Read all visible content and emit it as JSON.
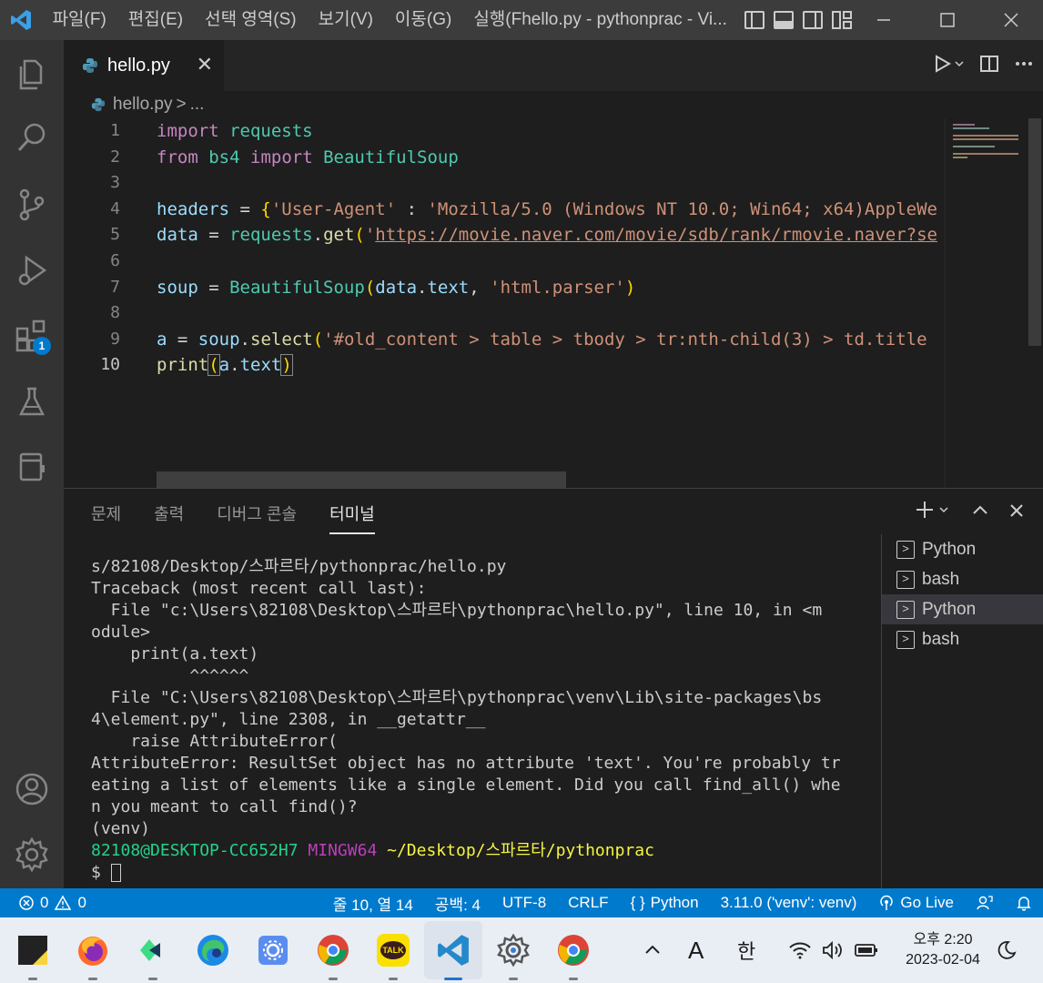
{
  "titlebar": {
    "menu": [
      "파일(F)",
      "편집(E)",
      "선택 영역(S)",
      "보기(V)",
      "이동(G)",
      "실행("
    ],
    "window_title": "hello.py - pythonprac - Vi...",
    "window_title_prefix": "F"
  },
  "activity": {
    "extensions_badge": "1"
  },
  "tab": {
    "label": "hello.py",
    "close": "✕"
  },
  "breadcrumb": {
    "file": "hello.py",
    "sep": ">",
    "more": "..."
  },
  "editor": {
    "line_numbers": [
      "1",
      "2",
      "3",
      "4",
      "5",
      "6",
      "7",
      "8",
      "9",
      "10"
    ],
    "lines": {
      "l1_kw": "import",
      "l1_mod": "requests",
      "l2_kw1": "from",
      "l2_mod1": "bs4",
      "l2_kw2": "import",
      "l2_mod2": "BeautifulSoup",
      "l4_var": "headers",
      "l4_op": " = ",
      "l4_brace": "{",
      "l4_str1": "'User-Agent'",
      "l4_colon": " : ",
      "l4_str2": "'Mozilla/5.0 (Windows NT 10.0; Win64; x64)AppleWe",
      "l5_var": "data",
      "l5_op": " = ",
      "l5_obj": "requests",
      "l5_dot": ".",
      "l5_fn": "get",
      "l5_paren": "(",
      "l5_quote": "'",
      "l5_url": "https://movie.naver.com/movie/sdb/rank/rmovie.naver?se",
      "l7_var": "soup",
      "l7_op": " = ",
      "l7_cls": "BeautifulSoup",
      "l7_paren": "(",
      "l7_arg1": "data",
      "l7_dot": ".",
      "l7_attr": "text",
      "l7_comma": ", ",
      "l7_str": "'html.parser'",
      "l7_close": ")",
      "l9_var": "a",
      "l9_op": " = ",
      "l9_obj": "soup",
      "l9_dot": ".",
      "l9_fn": "select",
      "l9_paren": "(",
      "l9_str": "'#old_content > table > tbody > tr:nth-child(3) > td.title",
      "l10_fn": "print",
      "l10_open": "(",
      "l10_var": "a",
      "l10_dot": ".",
      "l10_attr": "text",
      "l10_close": ")"
    }
  },
  "panel": {
    "tabs": [
      "문제",
      "출력",
      "디버그 콘솔",
      "터미널"
    ],
    "active_tab": "터미널",
    "terminal_lines": [
      "s/82108/Desktop/스파르타/pythonprac/hello.py",
      "Traceback (most recent call last):",
      "  File \"c:\\Users\\82108\\Desktop\\스파르타\\pythonprac\\hello.py\", line 10, in <m",
      "odule>",
      "    print(a.text)",
      "          ^^^^^^",
      "  File \"C:\\Users\\82108\\Desktop\\스파르타\\pythonprac\\venv\\Lib\\site-packages\\bs",
      "4\\element.py\", line 2308, in __getattr__",
      "    raise AttributeError(",
      "AttributeError: ResultSet object has no attribute 'text'. You're probably tr",
      "eating a list of elements like a single element. Did you call find_all() whe",
      "n you meant to call find()?",
      "(venv)"
    ],
    "prompt_user": "82108@DESKTOP-CC652H7",
    "prompt_env": "MINGW64",
    "prompt_path": "~/Desktop/스파르타/pythonprac",
    "prompt_symbol": "$",
    "terminals": [
      "Python",
      "bash",
      "Python",
      "bash"
    ]
  },
  "statusbar": {
    "errors": "0",
    "warnings": "0",
    "position": "줄 10, 열 14",
    "spaces": "공백: 4",
    "encoding": "UTF-8",
    "eol": "CRLF",
    "language": "Python",
    "interpreter": "3.11.0 ('venv': venv)",
    "golive": "Go Live"
  },
  "taskbar": {
    "ime_a": "A",
    "ime_han": "한",
    "time": "오후 2:20",
    "date": "2023-02-04",
    "kakao": "TALK"
  }
}
